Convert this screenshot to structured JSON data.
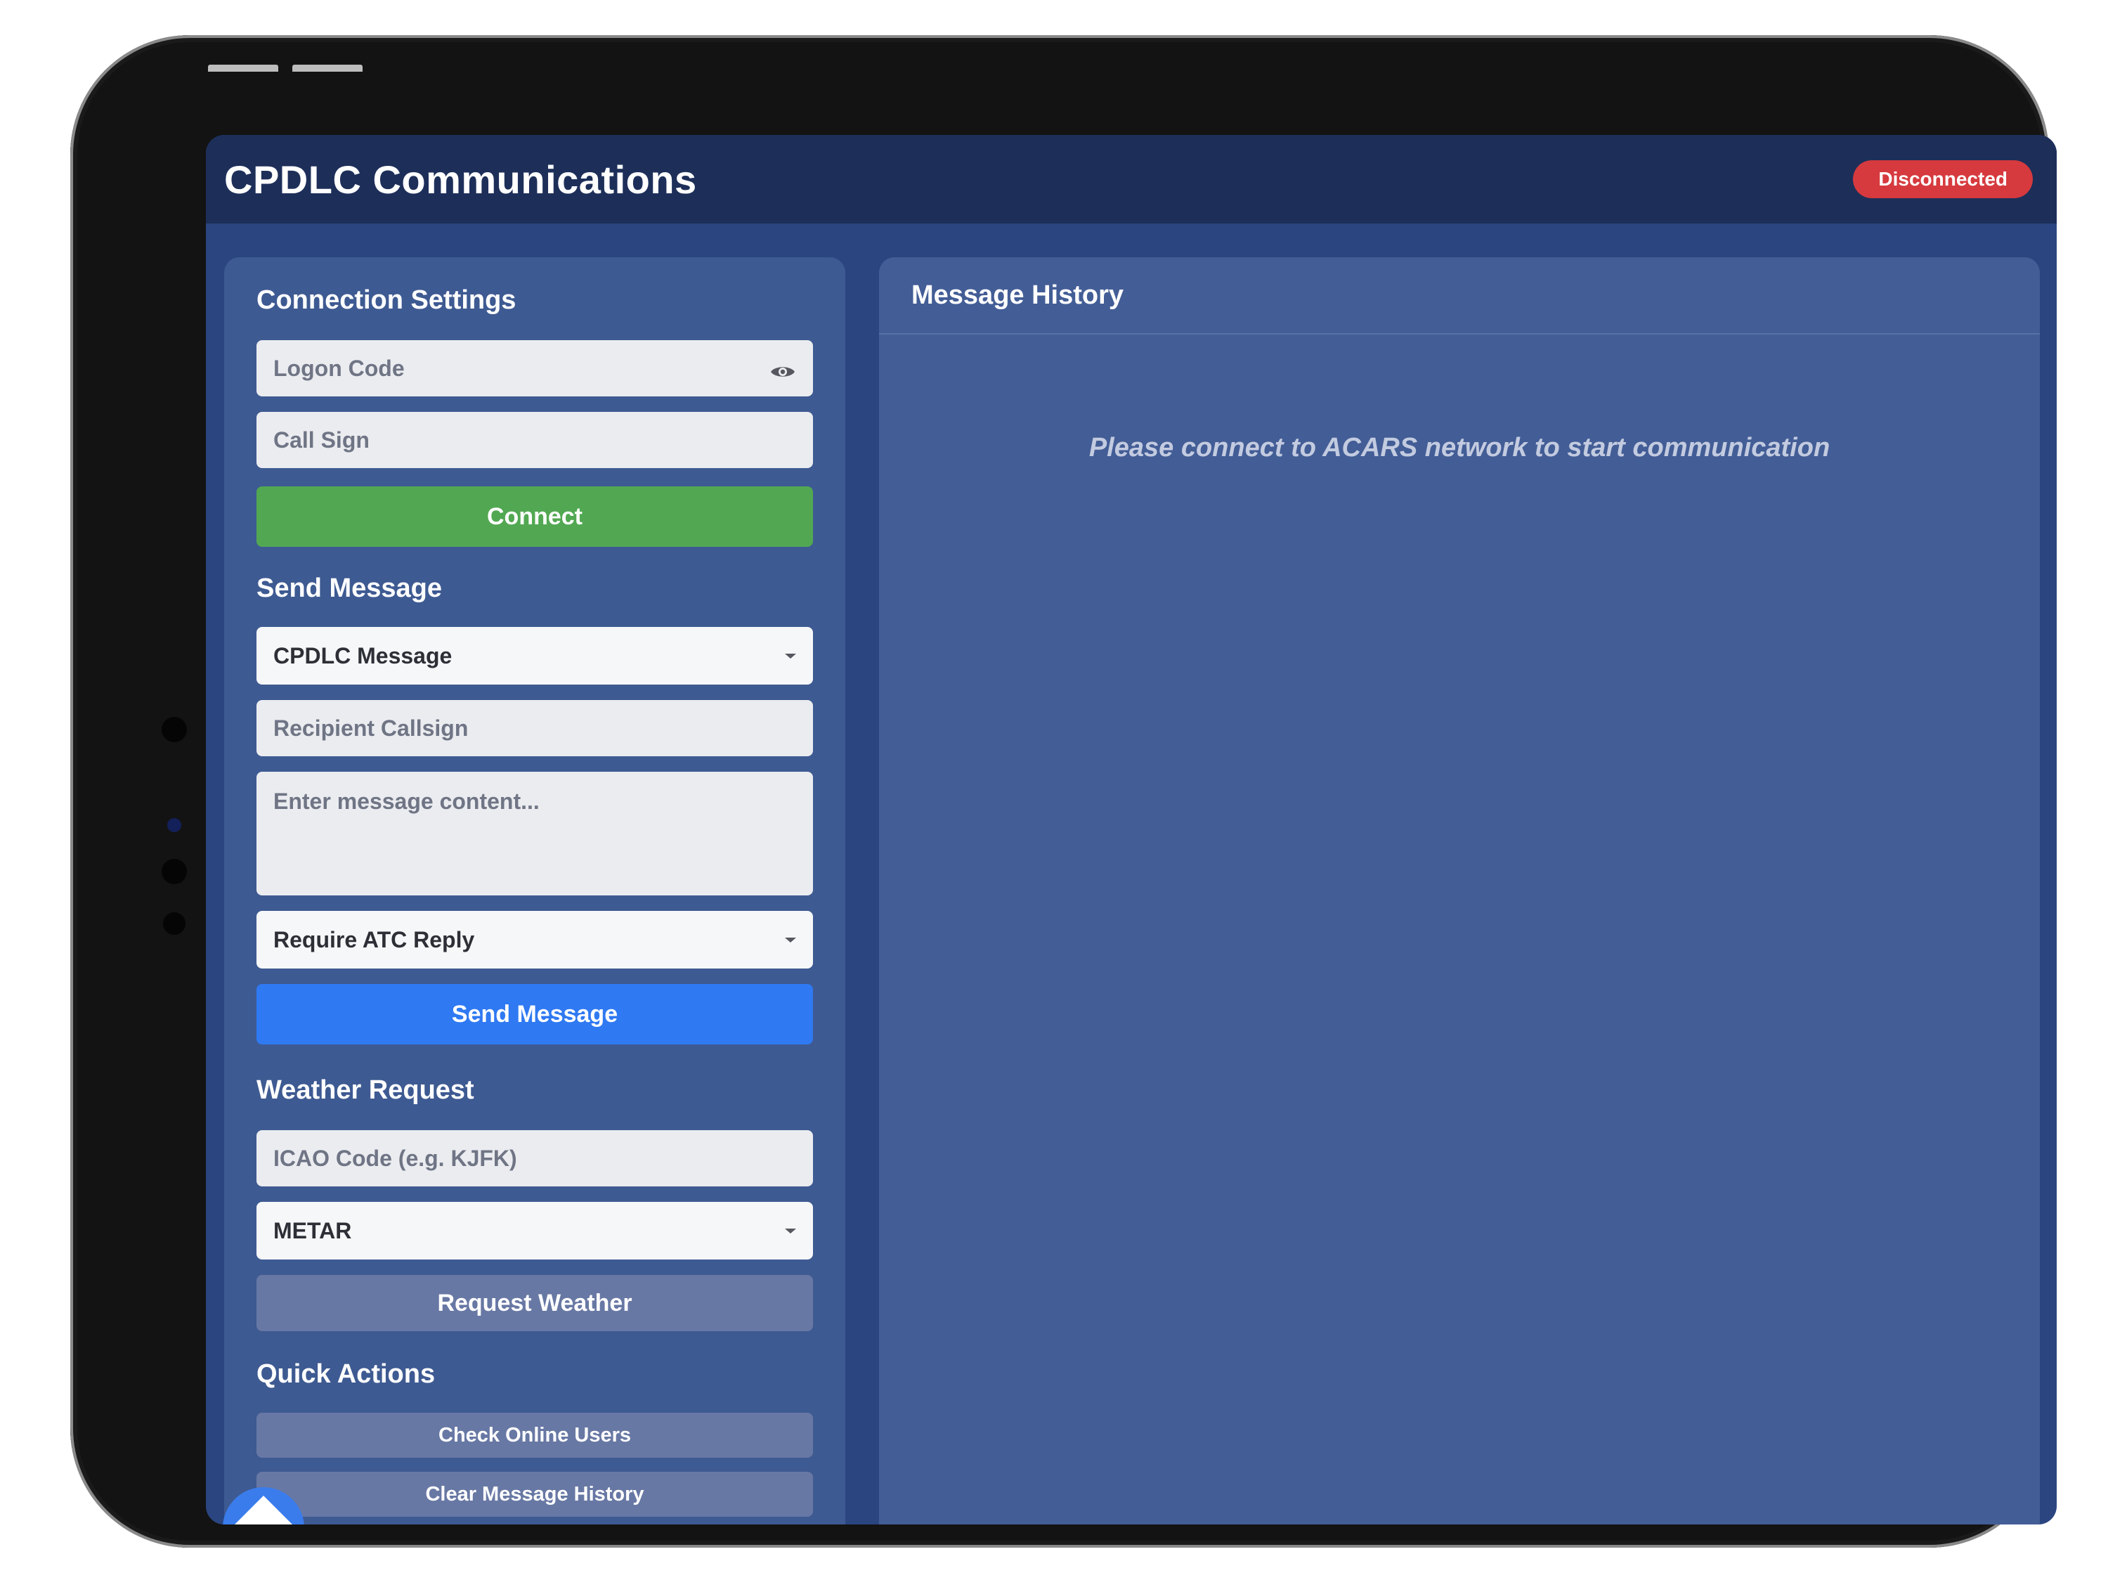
{
  "header": {
    "title": "CPDLC Communications",
    "status": "Disconnected",
    "status_color": "#d63a3e"
  },
  "connection": {
    "title": "Connection Settings",
    "logon_placeholder": "Logon Code",
    "callsign_placeholder": "Call Sign",
    "connect_label": "Connect"
  },
  "send": {
    "title": "Send Message",
    "message_type": "CPDLC Message",
    "recipient_placeholder": "Recipient Callsign",
    "content_placeholder": "Enter message content...",
    "reply_option": "Require ATC Reply",
    "send_label": "Send Message"
  },
  "weather": {
    "title": "Weather Request",
    "icao_placeholder": "ICAO Code (e.g. KJFK)",
    "report_type": "METAR",
    "request_label": "Request Weather"
  },
  "quick": {
    "title": "Quick Actions",
    "check_users": "Check Online Users",
    "clear_history": "Clear Message History"
  },
  "history": {
    "title": "Message History",
    "empty_text": "Please connect to ACARS network to start communication"
  },
  "icons": {
    "eye": "eye-icon",
    "fab": "home-icon"
  }
}
